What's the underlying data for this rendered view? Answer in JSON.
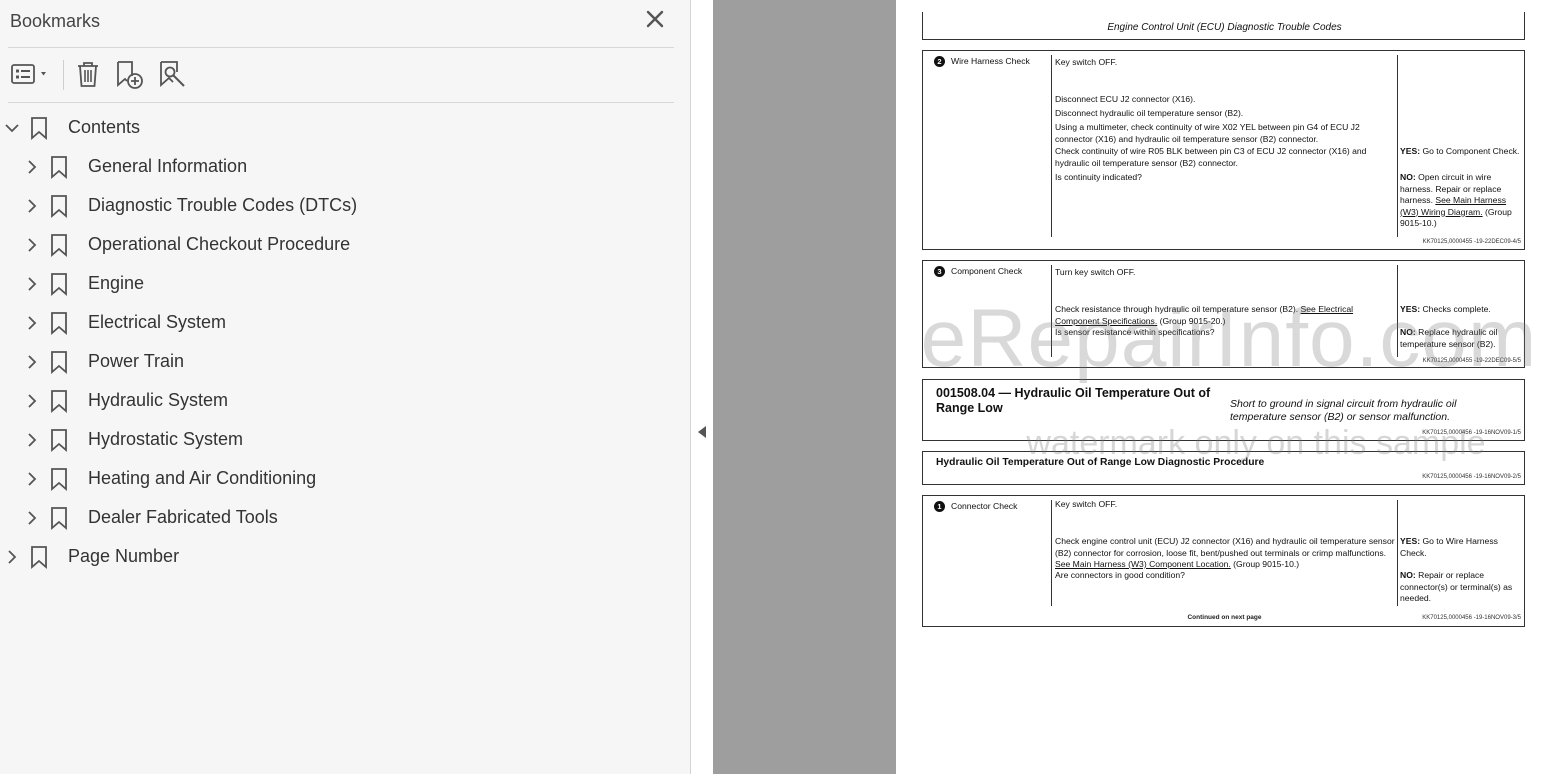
{
  "panel": {
    "title": "Bookmarks",
    "close_icon": "close-icon",
    "toolbar": {
      "options_icon": "options-menu-icon",
      "delete_icon": "trash-icon",
      "new_bookmark_icon": "new-bookmark-icon",
      "find_bookmark_icon": "find-bookmark-icon"
    }
  },
  "bookmarks": {
    "root": {
      "label": "Contents",
      "expanded": true
    },
    "children": [
      {
        "label": "General Information"
      },
      {
        "label": "Diagnostic Trouble Codes (DTCs)"
      },
      {
        "label": "Operational Checkout Procedure"
      },
      {
        "label": "Engine"
      },
      {
        "label": "Electrical System"
      },
      {
        "label": "Power Train"
      },
      {
        "label": "Hydraulic System"
      },
      {
        "label": "Hydrostatic System"
      },
      {
        "label": "Heating and Air Conditioning"
      },
      {
        "label": "Dealer Fabricated Tools"
      }
    ],
    "page_number": {
      "label": "Page Number"
    }
  },
  "document": {
    "header": "Engine Control Unit (ECU) Diagnostic Trouble Codes",
    "step2": {
      "num": "2",
      "title": "Wire Harness Check",
      "p1": "Key switch OFF.",
      "p2": "Disconnect ECU J2 connector (X16).",
      "p3": "Disconnect hydraulic oil temperature sensor (B2).",
      "p4": "Using a multimeter, check continuity of wire X02 YEL between pin G4 of ECU J2 connector (X16) and hydraulic oil temperature sensor (B2) connector.",
      "p5": "Check continuity of wire R05 BLK between pin C3 of ECU J2 connector (X16) and hydraulic oil temperature sensor (B2) connector.",
      "p6": "Is continuity indicated?",
      "yes_label": "YES:",
      "yes_text": "Go to Component Check.",
      "no_label": "NO:",
      "no_text": "Open circuit in wire harness. Repair or replace harness.",
      "no_link": "See Main Harness (W3) Wiring Diagram.",
      "no_group": "(Group 9015-10.)",
      "ref": "KK70125,0000455 -19-22DEC09-4/5"
    },
    "step3": {
      "num": "3",
      "title": "Component Check",
      "p1": "Turn key switch OFF.",
      "p2": "Check resistance through hydraulic oil temperature sensor (B2).",
      "p2_link": "See Electrical Component Specifications.",
      "p2_group": "(Group 9015-20.)",
      "p3": "Is sensor resistance within specifications?",
      "yes_label": "YES:",
      "yes_text": "Checks complete.",
      "no_label": "NO:",
      "no_text": "Replace hydraulic oil temperature sensor (B2).",
      "ref": "KK70125,0000455 -19-22DEC09-5/5"
    },
    "dtc": {
      "title": "001508.04 — Hydraulic Oil Temperature Out of Range Low",
      "desc": "Short to ground in signal circuit from hydraulic oil temperature sensor (B2) or sensor malfunction.",
      "ref": "KK70125,0000456 -19-16NOV09-1/5"
    },
    "procedure": {
      "title": "Hydraulic Oil Temperature Out of Range Low Diagnostic Procedure",
      "ref": "KK70125,0000456 -19-16NOV09-2/5"
    },
    "step1": {
      "num": "1",
      "title": "Connector Check",
      "p1": "Key switch OFF.",
      "p2": "Check engine control unit (ECU) J2 connector (X16) and hydraulic oil temperature sensor (B2) connector for corrosion, loose fit, bent/pushed out terminals or crimp malfunctions.",
      "p2_link": "See Main Harness (W3) Component Location.",
      "p2_group": "(Group 9015-10.)",
      "p3": "Are connectors in good condition?",
      "yes_label": "YES:",
      "yes_text": "Go to Wire Harness Check.",
      "no_label": "NO:",
      "no_text": "Repair or replace connector(s) or terminal(s) as needed.",
      "continued": "Continued on next page",
      "ref": "KK70125,0000456 -19-16NOV09-3/5"
    },
    "watermark": "eRepairInfo.com",
    "watermark_sub": "watermark only on this sample"
  },
  "colors": {
    "panel_bg": "#f6f6f6",
    "gutter": "#9e9e9e",
    "icon": "#555555"
  }
}
